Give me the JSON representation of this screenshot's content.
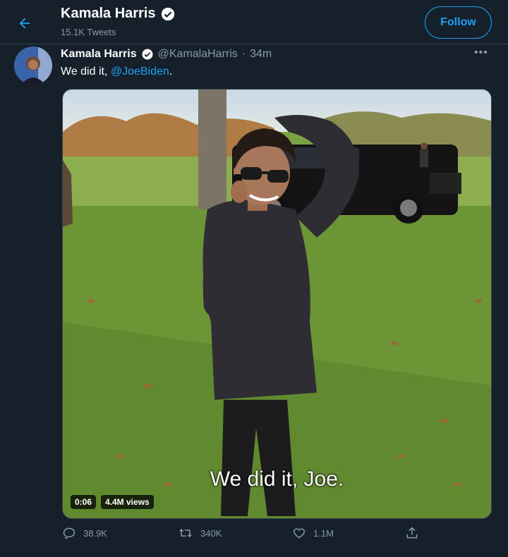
{
  "header": {
    "back_icon": "arrow-left-icon",
    "name": "Kamala Harris",
    "tweet_count": "15.1K Tweets",
    "follow_label": "Follow"
  },
  "tweet": {
    "author_name": "Kamala Harris",
    "handle": "@KamalaHarris",
    "separator": "·",
    "time": "34m",
    "more_icon": "more-horizontal-icon",
    "more_glyph": "•••",
    "text_prefix": "We did it, ",
    "mention": "@JoeBiden",
    "text_suffix": "."
  },
  "media": {
    "caption": "We did it, Joe.",
    "duration": "0:06",
    "views": "4.4M views"
  },
  "actions": {
    "reply_count": "38.9K",
    "retweet_count": "340K",
    "like_count": "1.1M"
  },
  "colors": {
    "background": "#15202b",
    "accent": "#1da1f2",
    "muted": "#8899a6",
    "divider": "#38444d"
  }
}
